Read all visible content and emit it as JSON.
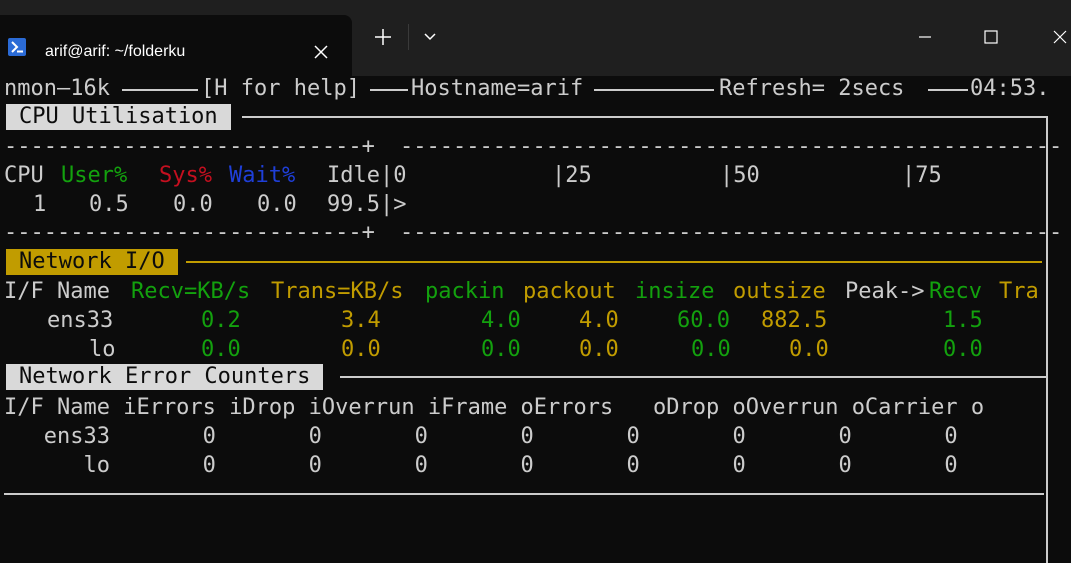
{
  "window": {
    "tab_title": "arif@arif: ~/folderku",
    "new_tab_symbol": "+",
    "minimize_symbol": "—",
    "maximize_symbol": "☐",
    "close_symbol": "✕"
  },
  "nmon": {
    "header": {
      "prefix": "nmon—16k",
      "help": "[H for help]",
      "hostname": "Hostname=arif",
      "refresh": "Refresh= 2secs",
      "time": "04:53."
    },
    "cpu": {
      "section_title": "CPU Utilisation",
      "dash_left": "---------------------------+",
      "dash_right": "--------------------------------------------------",
      "col_cpu": "CPU",
      "col_user": "User%",
      "col_sys": "Sys%",
      "col_wait": "Wait%",
      "col_idle": "Idle|0",
      "scale_25": "|25",
      "scale_50": "|50",
      "scale_75": "|75",
      "row_cpu": "1",
      "row_user": "0.5",
      "row_sys": "0.0",
      "row_wait": "0.0",
      "row_idle": "99.5|>"
    },
    "network": {
      "section_title": "Network I/O",
      "headers": {
        "ifname": "I/F Name",
        "recv": "Recv=KB/s",
        "trans": "Trans=KB/s",
        "packin": "packin",
        "packout": "packout",
        "insize": "insize",
        "outsize": "outsize",
        "peak": "Peak->",
        "peak_recv": "Recv",
        "peak_trans": "Tra"
      },
      "rows": [
        {
          "name": "ens33",
          "recv": "0.2",
          "trans": "3.4",
          "packin": "4.0",
          "packout": "4.0",
          "insize": "60.0",
          "outsize": "882.5",
          "peak_recv": "1.5"
        },
        {
          "name": "lo",
          "recv": "0.0",
          "trans": "0.0",
          "packin": "0.0",
          "packout": "0.0",
          "insize": "0.0",
          "outsize": "0.0",
          "peak_recv": "0.0"
        }
      ]
    },
    "errors": {
      "section_title": "Network Error Counters",
      "header": "I/F Name iErrors iDrop iOverrun iFrame oErrors   oDrop oOverrun oCarrier o",
      "rows": [
        {
          "line": "   ens33       0       0       0       0       0       0       0       0"
        },
        {
          "line": "      lo       0       0       0       0       0       0       0       0"
        }
      ]
    }
  },
  "colors": {
    "background": "#0c0c0c",
    "titlebar": "#1f1f1f",
    "green": "#13a10e",
    "red": "#c50f1f",
    "blue": "#1f3fd9",
    "yellow": "#c19c00",
    "text": "#cccccc"
  }
}
